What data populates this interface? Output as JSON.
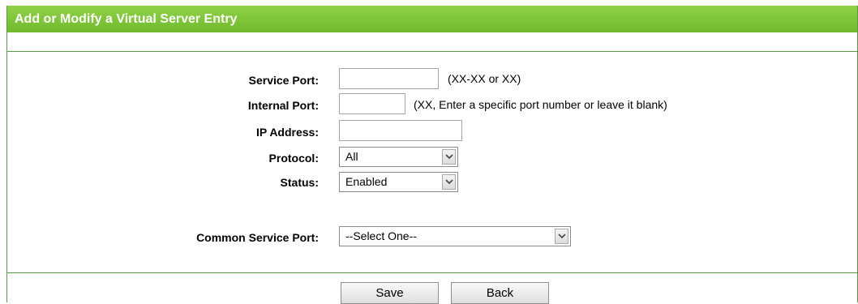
{
  "title": "Add or Modify a Virtual Server Entry",
  "form": {
    "service_port": {
      "label": "Service Port:",
      "value": "",
      "hint": "(XX-XX or XX)"
    },
    "internal_port": {
      "label": "Internal Port:",
      "value": "",
      "hint": "(XX, Enter a specific port number or leave it blank)"
    },
    "ip_address": {
      "label": "IP Address:",
      "value": ""
    },
    "protocol": {
      "label": "Protocol:",
      "selected": "All"
    },
    "status": {
      "label": "Status:",
      "selected": "Enabled"
    },
    "common_service_port": {
      "label": "Common Service Port:",
      "selected": "--Select One--"
    }
  },
  "buttons": {
    "save": "Save",
    "back": "Back"
  },
  "colors": {
    "header_green": "#7ac13a",
    "rule_green": "#5a9a46"
  }
}
